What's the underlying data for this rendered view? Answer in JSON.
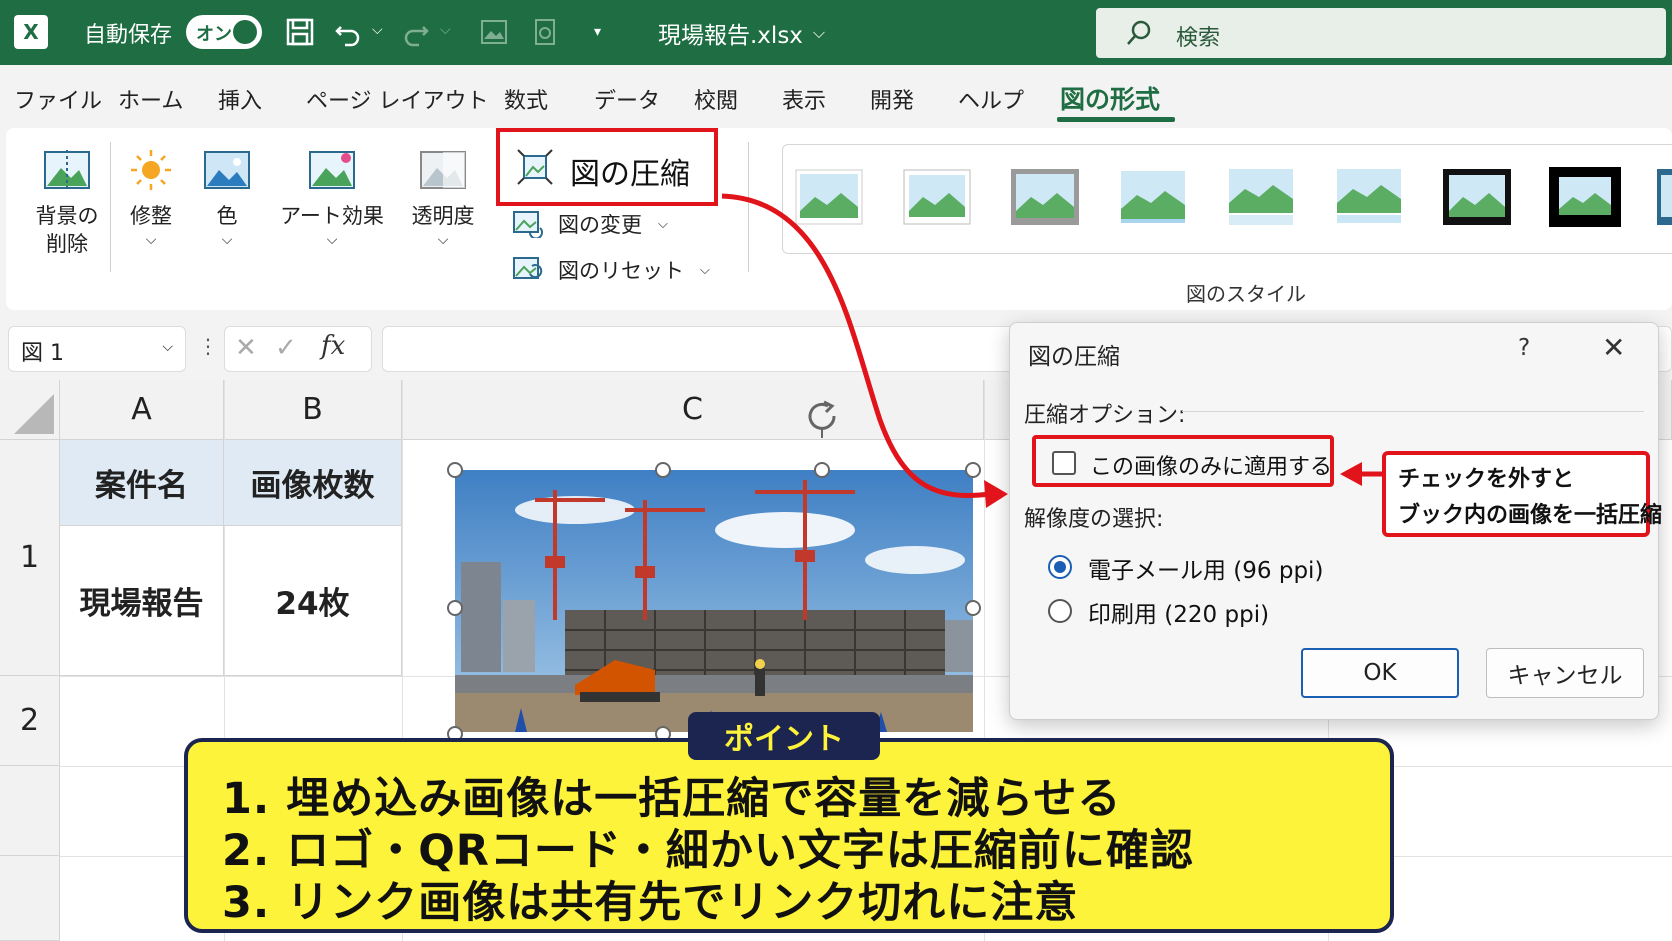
{
  "titlebar": {
    "autosave_label": "自動保存",
    "toggle_text": "オン",
    "filename": "現場報告.xlsx",
    "search_placeholder": "検索"
  },
  "menu": {
    "tabs": [
      "ファイル",
      "ホーム",
      "挿入",
      "ページ レイアウト",
      "数式",
      "データ",
      "校閲",
      "表示",
      "開発",
      "ヘルプ"
    ],
    "active_tab": "図の形式"
  },
  "ribbon": {
    "remove_bg": [
      "背景の",
      "削除"
    ],
    "corrections": "修整",
    "color": "色",
    "artistic": "アート効果",
    "transparency": "透明度",
    "compress": "図の圧縮",
    "change_picture": "図の変更",
    "reset_picture": "図のリセット",
    "styles_label": "図のスタイル"
  },
  "formula_bar": {
    "name_box": "図 1",
    "fx": "fx"
  },
  "sheet": {
    "columns": [
      "A",
      "B",
      "C"
    ],
    "rows": [
      "1",
      "2"
    ],
    "header_row": [
      "案件名",
      "画像枚数"
    ],
    "data_row": [
      "現場報告",
      "24枚"
    ]
  },
  "dialog": {
    "title": "図の圧縮",
    "help": "?",
    "compress_options_label": "圧縮オプション:",
    "apply_only_label": "この画像のみに適用する",
    "apply_only_checked": false,
    "resolution_label": "解像度の選択:",
    "resolutions": [
      {
        "label": "電子メール用 (96 ppi)",
        "selected": true
      },
      {
        "label": "印刷用 (220 ppi)",
        "selected": false
      }
    ],
    "ok": "OK",
    "cancel": "キャンセル"
  },
  "callout": {
    "line1": "チェックを外すと",
    "line2": "ブック内の画像を一括圧縮"
  },
  "point": {
    "tag": "ポイント",
    "lines": [
      "1. 埋め込み画像は一括圧縮で容量を減らせる",
      "2. ロゴ・QRコード・細かい文字は圧縮前に確認",
      "3. リンク画像は共有先でリンク切れに注意"
    ]
  },
  "colors": {
    "excel_green": "#1f6e43",
    "highlight_red": "#e0141a",
    "point_yellow": "#fdf33a",
    "point_navy": "#1c2550",
    "selection_blue": "#1a5fb4"
  }
}
